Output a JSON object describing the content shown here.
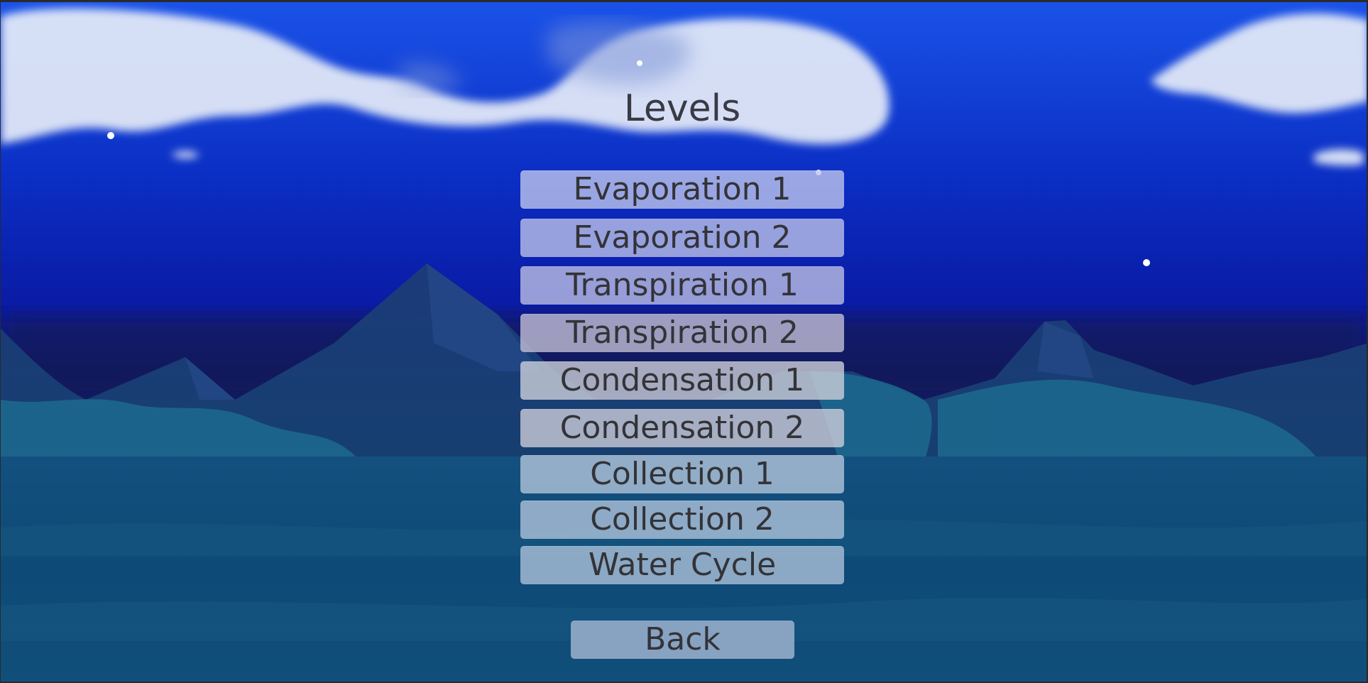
{
  "screen": {
    "title": "Levels"
  },
  "levels": [
    {
      "label": "Evaporation 1",
      "color": "rgba(190,198,236,0.80)"
    },
    {
      "label": "Evaporation 2",
      "color": "rgba(186,192,232,0.80)"
    },
    {
      "label": "Transpiration 1",
      "color": "rgba(186,190,228,0.80)"
    },
    {
      "label": "Transpiration 2",
      "color": "rgba(194,190,212,0.80)"
    },
    {
      "label": "Condensation 1",
      "color": "rgba(204,208,218,0.80)"
    },
    {
      "label": "Condensation 2",
      "color": "rgba(204,204,216,0.80)"
    },
    {
      "label": "Collection 1",
      "color": "rgba(188,204,224,0.75)"
    },
    {
      "label": "Collection 2",
      "color": "rgba(184,202,224,0.75)"
    },
    {
      "label": "Water Cycle",
      "color": "rgba(182,200,222,0.75)"
    }
  ],
  "back_button": {
    "label": "Back"
  },
  "colors": {
    "sky_top": "#0a39c8",
    "sky_mid": "#0b1aa0",
    "sky_low": "#0a1366",
    "mountain": "#1f3f80",
    "sea": "#0f4f7d",
    "text": "#333338"
  }
}
